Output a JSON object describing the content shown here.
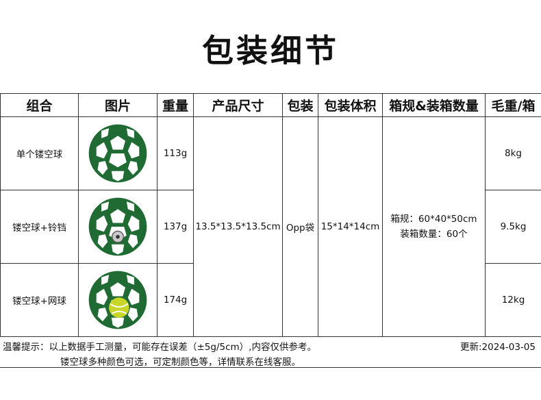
{
  "title": "包装细节",
  "headers": [
    "组合",
    "图片",
    "重量",
    "产品尺寸",
    "包装",
    "包装体积",
    "箱规&装箱数量",
    "毛重/箱"
  ],
  "rows": [
    {
      "name": "单个镂空球",
      "weight": "113g",
      "gross": "8kg",
      "image": "hollow-ball-icon"
    },
    {
      "name": "镂空球+铃铛",
      "weight": "137g",
      "gross": "9.5kg",
      "image": "hollow-ball-with-bell-icon"
    },
    {
      "name": "镂空球+网球",
      "weight": "174g",
      "gross": "12kg",
      "image": "hollow-ball-with-tennis-ball-icon"
    }
  ],
  "shared": {
    "size": "13.5*13.5*13.5cm",
    "package": "Opp袋",
    "volume": "15*14*14cm",
    "carton_line1": "箱规：60*40*50cm",
    "carton_line2": "装箱数量：60个"
  },
  "notes": {
    "line1": "温馨提示：以上数据手工测量，可能存在误差（±5g/5cm）,内容仅供参考。",
    "line2": "镂空球多种颜色可选，可定制颜色等，详情联系在线客服。",
    "update": "更新:2024-03-05"
  },
  "colors": {
    "ball_green": "#1f6b33",
    "ball_dark": "#0f4a22",
    "tennis": "#c8d62a",
    "bell": "#c9c9c9"
  }
}
